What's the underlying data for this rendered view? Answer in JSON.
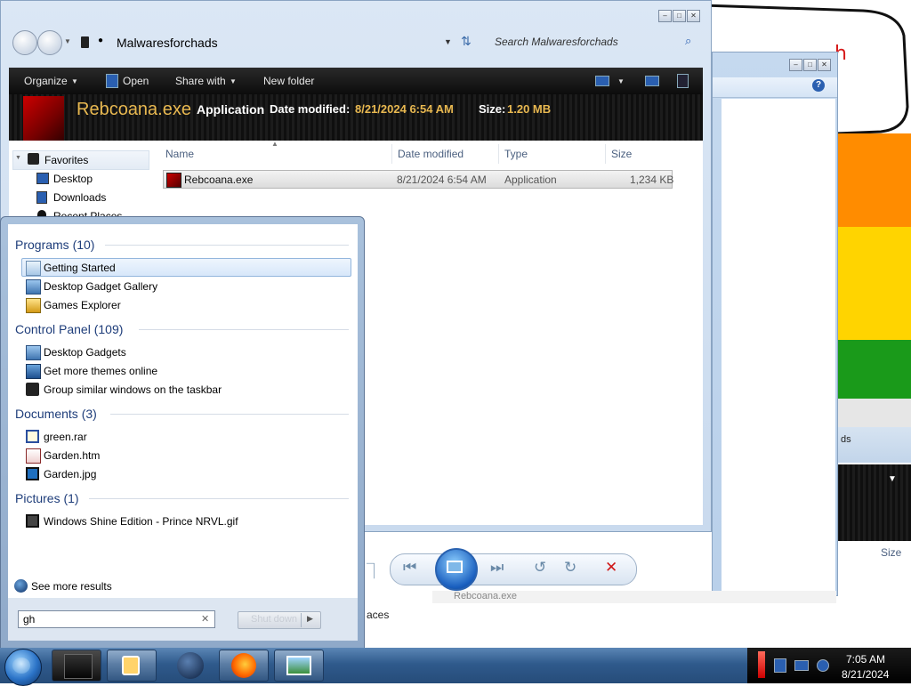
{
  "explorer": {
    "address_path": "Malwaresforchads",
    "search_placeholder": "Search Malwaresforchads",
    "commands": {
      "organize": "Organize",
      "open": "Open",
      "share_with": "Share with",
      "new_folder": "New folder"
    },
    "details": {
      "name": "Rebcoana.exe",
      "type": "Application",
      "date_label": "Date modified:",
      "date": "8/21/2024 6:54 AM",
      "size_label": "Size:",
      "size": "1.20 MB"
    },
    "nav": {
      "favorites": "Favorites",
      "desktop": "Desktop",
      "downloads": "Downloads",
      "recent": "Recent Places"
    },
    "columns": {
      "name": "Name",
      "date": "Date modified",
      "type": "Type",
      "size": "Size"
    },
    "file": {
      "name": "Rebcoana.exe",
      "date": "8/21/2024 6:54 AM",
      "type": "Application",
      "size": "1,234 KB"
    }
  },
  "background_window": {
    "places_text": "aces",
    "size_col": "Size",
    "side_text": "ds",
    "file_text": "Rebcoana.exe"
  },
  "start_menu": {
    "groups": {
      "programs": "Programs (10)",
      "control_panel": "Control Panel (109)",
      "documents": "Documents (3)",
      "pictures": "Pictures (1)"
    },
    "programs": [
      "Getting Started",
      "Desktop Gadget Gallery",
      "Games Explorer"
    ],
    "control_panel": [
      "Desktop Gadgets",
      "Get more themes online",
      "Group similar windows on the taskbar"
    ],
    "documents": [
      "green.rar",
      "Garden.htm",
      "Garden.jpg"
    ],
    "pictures": [
      "Windows Shine Edition - Prince NRVL.gif"
    ],
    "see_more": "See more results",
    "search_value": "gh",
    "shutdown": "Shut down"
  },
  "bubble_text": "h",
  "tray": {
    "time": "7:05 AM",
    "date": "8/21/2024"
  },
  "colors": {
    "accent": "#2f5a8c",
    "file_text": "#e8b850",
    "red": "#ee0000",
    "orange": "#ff8800",
    "yellow": "#ffd400",
    "green": "#1a9a1a"
  }
}
